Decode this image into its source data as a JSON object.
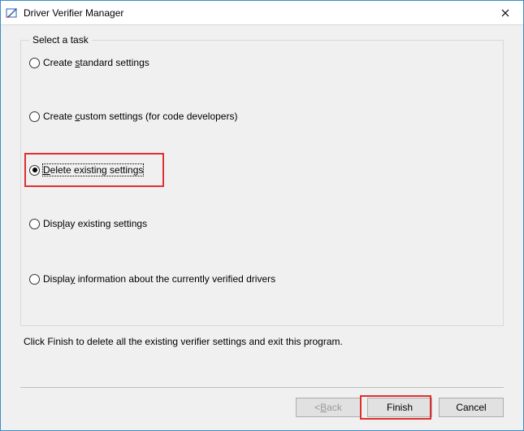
{
  "window": {
    "title": "Driver Verifier Manager"
  },
  "group": {
    "legend": "Select a task"
  },
  "options": {
    "o1_pre": "Create ",
    "o1_u": "s",
    "o1_post": "tandard settings",
    "o2_pre": "Create ",
    "o2_u": "c",
    "o2_post": "ustom settings (for code developers)",
    "o3_u": "D",
    "o3_post": "elete existing settings",
    "o4_pre": "Disp",
    "o4_u": "l",
    "o4_post": "ay existing settings",
    "o5_pre": "Displa",
    "o5_u": "y",
    "o5_post": " information about the currently verified drivers"
  },
  "instruction": "Click Finish to delete all the existing verifier settings and exit this program.",
  "buttons": {
    "back_pre": "< ",
    "back_u": "B",
    "back_post": "ack",
    "finish": "Finish",
    "cancel": "Cancel"
  }
}
